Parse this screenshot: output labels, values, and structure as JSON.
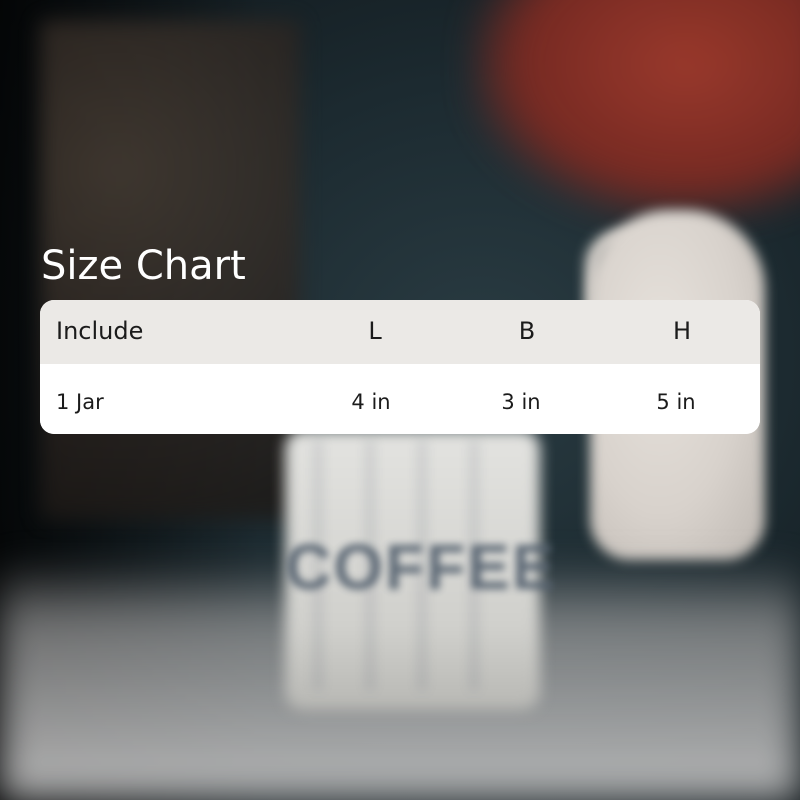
{
  "title": "Size Chart",
  "table": {
    "headers": [
      "Include",
      "L",
      "B",
      "H"
    ],
    "rows": [
      [
        "1 Jar",
        "4 in",
        "3 in",
        "5 in"
      ]
    ]
  },
  "background": {
    "jar_text": "COFFEE"
  },
  "colors": {
    "title_text": "#ffffff",
    "header_bg": "#ebe9e6",
    "row_bg": "#ffffff",
    "table_text": "#1b1b1b"
  }
}
